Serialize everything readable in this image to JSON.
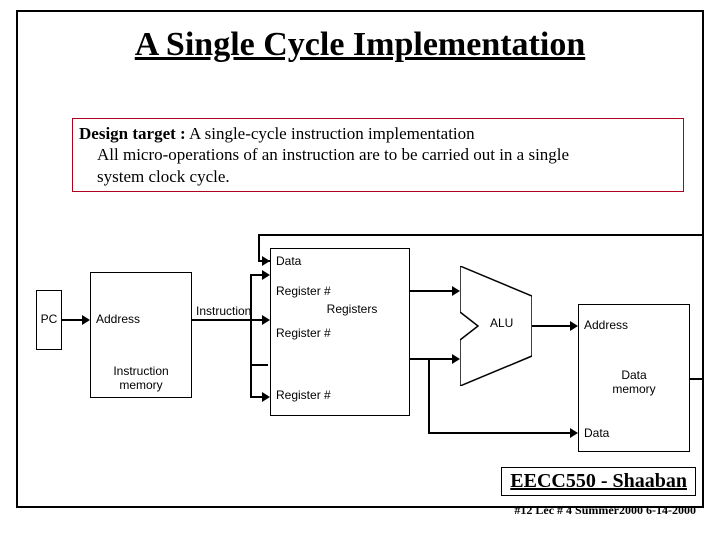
{
  "title": "A Single Cycle Implementation",
  "design": {
    "lead": "Design target :",
    "subtitle": " A single-cycle instruction implementation",
    "line2": "All micro-operations of an instruction are to be carried out in a single",
    "line3": "system clock cycle."
  },
  "labels": {
    "pc": "PC",
    "address1": "Address",
    "instr_mem": "Instruction",
    "instr_mem2": "memory",
    "instruction": "Instruction",
    "reg1": "Register #",
    "reg2": "Register #",
    "reg3": "Register #",
    "data_in": "Data",
    "registers": "Registers",
    "alu": "ALU",
    "address2": "Address",
    "data_mem": "Data",
    "data_mem2": "memory",
    "data_out": "Data"
  },
  "footer": {
    "course": "EECC550 - Shaaban",
    "line": "#12  Lec # 4   Summer2000    6-14-2000"
  }
}
